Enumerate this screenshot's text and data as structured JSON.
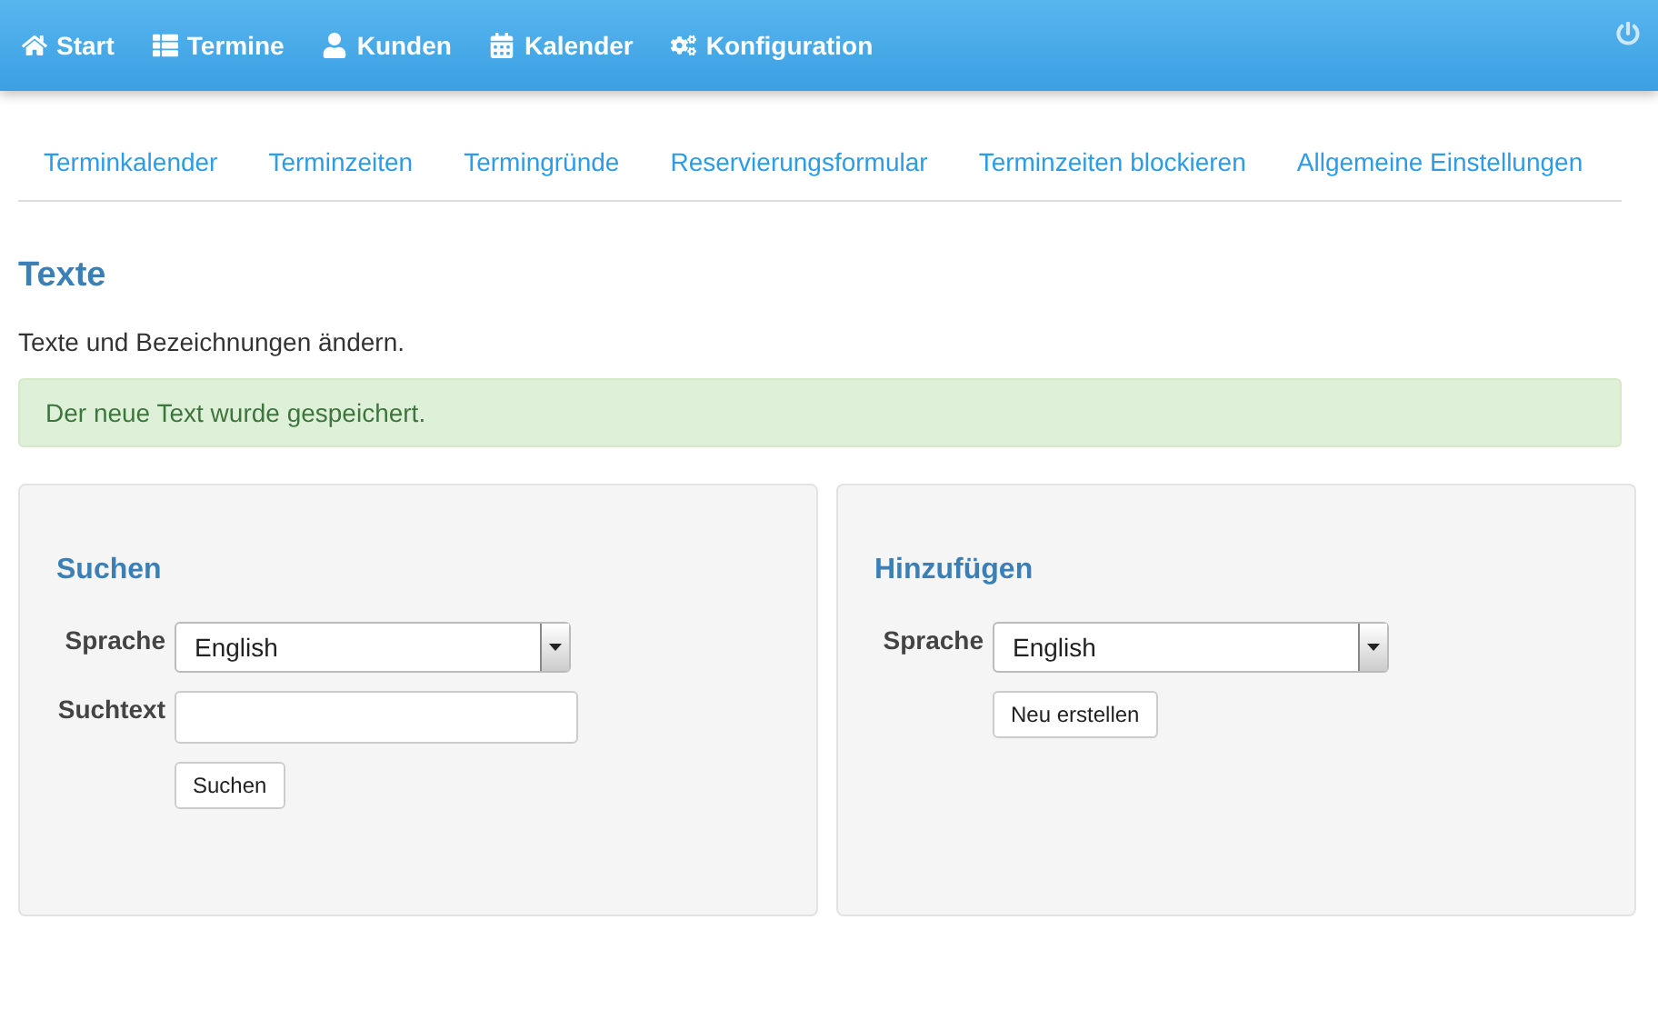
{
  "navbar": {
    "items": [
      {
        "label": "Start"
      },
      {
        "label": "Termine"
      },
      {
        "label": "Kunden"
      },
      {
        "label": "Kalender"
      },
      {
        "label": "Konfiguration"
      }
    ]
  },
  "subnav": {
    "items": [
      {
        "label": "Terminkalender"
      },
      {
        "label": "Terminzeiten"
      },
      {
        "label": "Termingründe"
      },
      {
        "label": "Reservierungsformular"
      },
      {
        "label": "Terminzeiten blockieren"
      },
      {
        "label": "Allgemeine Einstellungen"
      }
    ]
  },
  "heading": "Texte",
  "description": "Texte und Bezeichnungen ändern.",
  "alert": "Der neue Text wurde gespeichert.",
  "panels": [
    {
      "title": "Suchen",
      "fields": [
        {
          "kind": "select",
          "label": "Sprache",
          "value": "English"
        },
        {
          "kind": "text",
          "label": "Suchtext"
        }
      ],
      "button": "Suchen"
    },
    {
      "title": "Hinzufügen",
      "fields": [
        {
          "kind": "select",
          "label": "Sprache",
          "value": "English"
        }
      ],
      "button": "Neu erstellen"
    }
  ]
}
